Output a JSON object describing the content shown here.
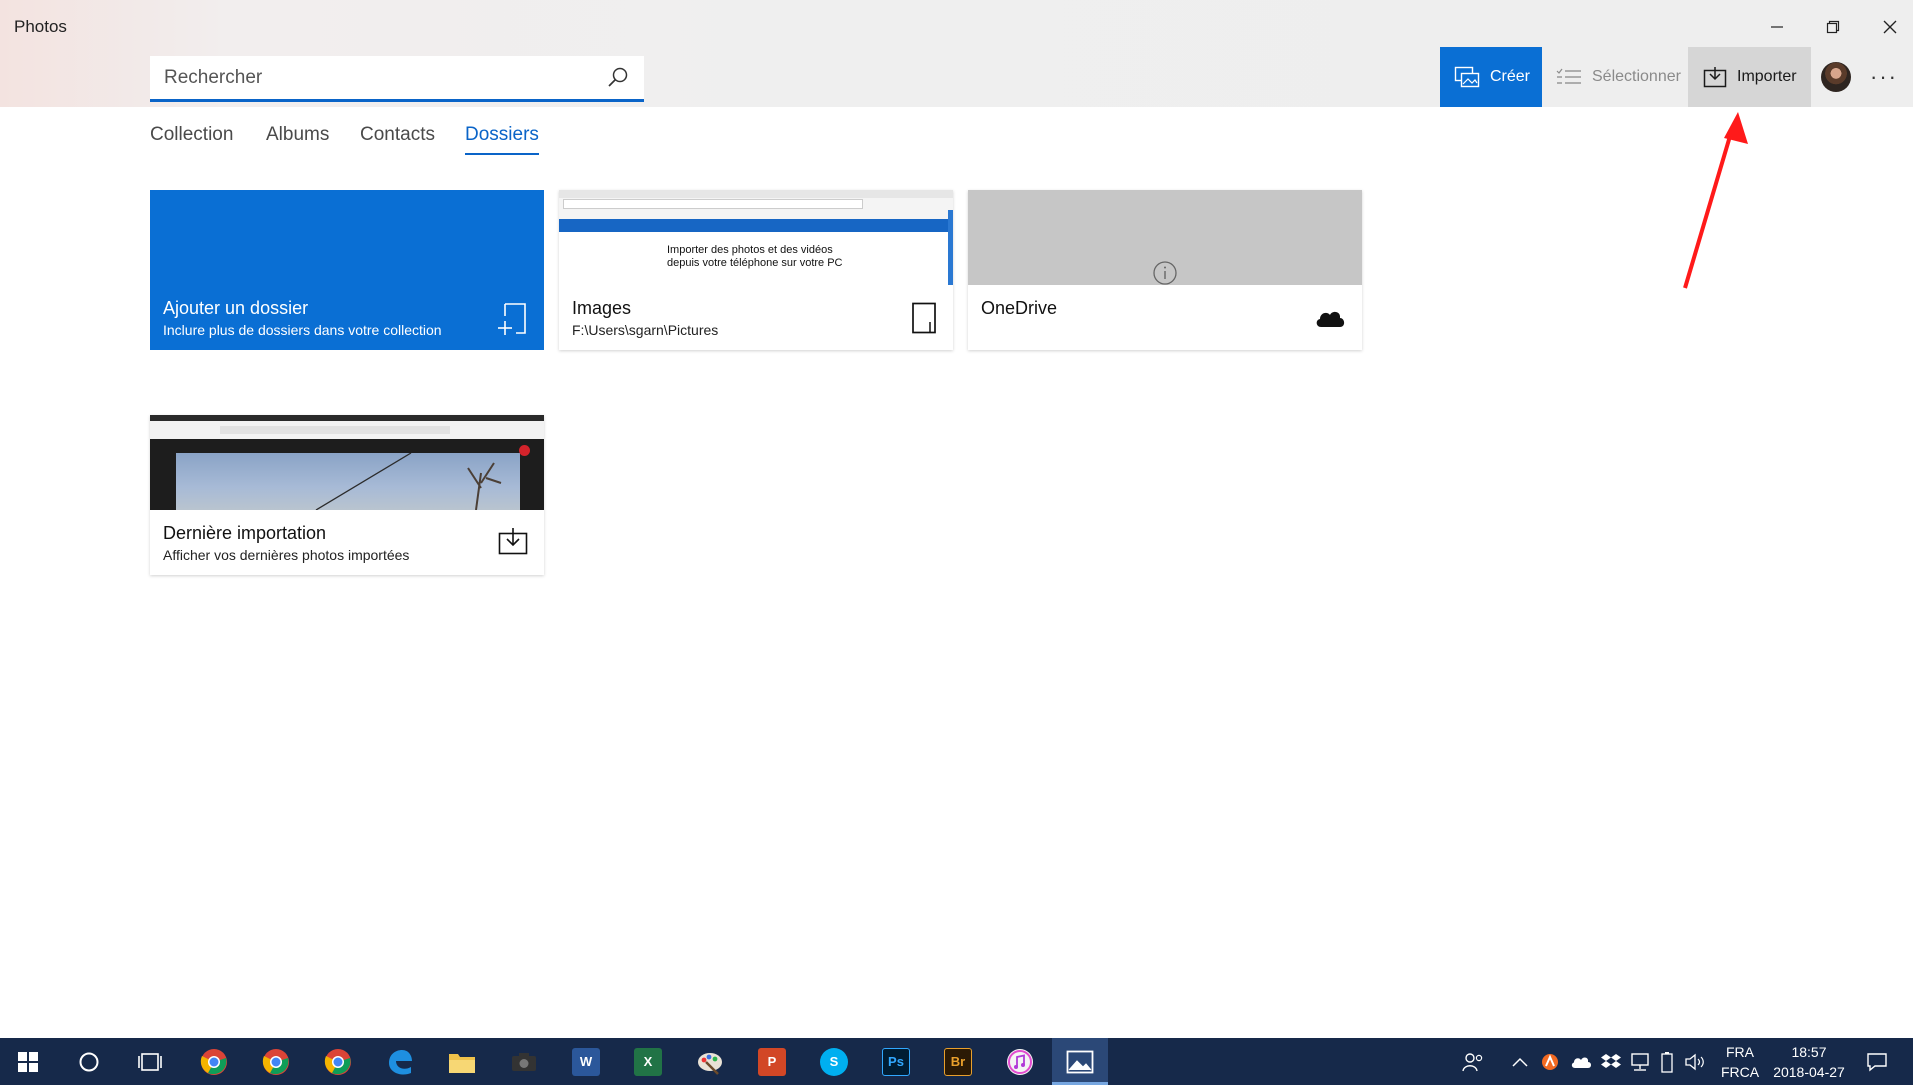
{
  "window": {
    "title": "Photos",
    "minimize_icon": "minimize-icon",
    "restore_icon": "restore-icon",
    "close_icon": "close-icon"
  },
  "search": {
    "placeholder": "Rechercher",
    "value": "",
    "icon": "search-icon"
  },
  "commands": {
    "create_label": "Créer",
    "select_label": "Sélectionner",
    "import_label": "Importer",
    "more_label": "···"
  },
  "tabs": [
    {
      "label": "Collection",
      "active": false
    },
    {
      "label": "Albums",
      "active": false
    },
    {
      "label": "Contacts",
      "active": false
    },
    {
      "label": "Dossiers",
      "active": true
    }
  ],
  "tiles": {
    "add_folder": {
      "title": "Ajouter un dossier",
      "subtitle": "Inclure plus de dossiers dans votre collection",
      "icon": "add-folder-icon"
    },
    "images": {
      "title": "Images",
      "subtitle": "F:\\Users\\sgarn\\Pictures",
      "icon": "device-folder-icon",
      "thumb_text": "Importer des photos et des vidéos depuis votre téléphone sur votre PC"
    },
    "onedrive": {
      "title": "OneDrive",
      "icon": "cloud-icon"
    },
    "last_import": {
      "title": "Dernière importation",
      "subtitle": "Afficher vos dernières photos importées",
      "icon": "import-icon"
    }
  },
  "annotation": {
    "color": "#ff1a1a",
    "points_to": "Importer"
  },
  "colors": {
    "accent": "#0a6fd4",
    "taskbar": "#16294a"
  },
  "taskbar": {
    "apps": [
      "start-icon",
      "cortana-icon",
      "task-view-icon",
      "chrome-icon",
      "chrome-icon",
      "chrome-icon",
      "edge-icon",
      "file-explorer-icon",
      "camera-icon",
      "word-icon",
      "excel-icon",
      "paint-icon",
      "powerpoint-icon",
      "skype-icon",
      "photoshop-icon",
      "bridge-icon",
      "itunes-icon",
      "photos-icon"
    ],
    "word_label": "W",
    "excel_label": "X",
    "powerpoint_label": "P",
    "skype_label": "S",
    "photoshop_label": "Ps",
    "bridge_label": "Br",
    "lang_top": "FRA",
    "lang_bottom": "FRCA",
    "time": "18:57",
    "date": "2018-04-27"
  }
}
